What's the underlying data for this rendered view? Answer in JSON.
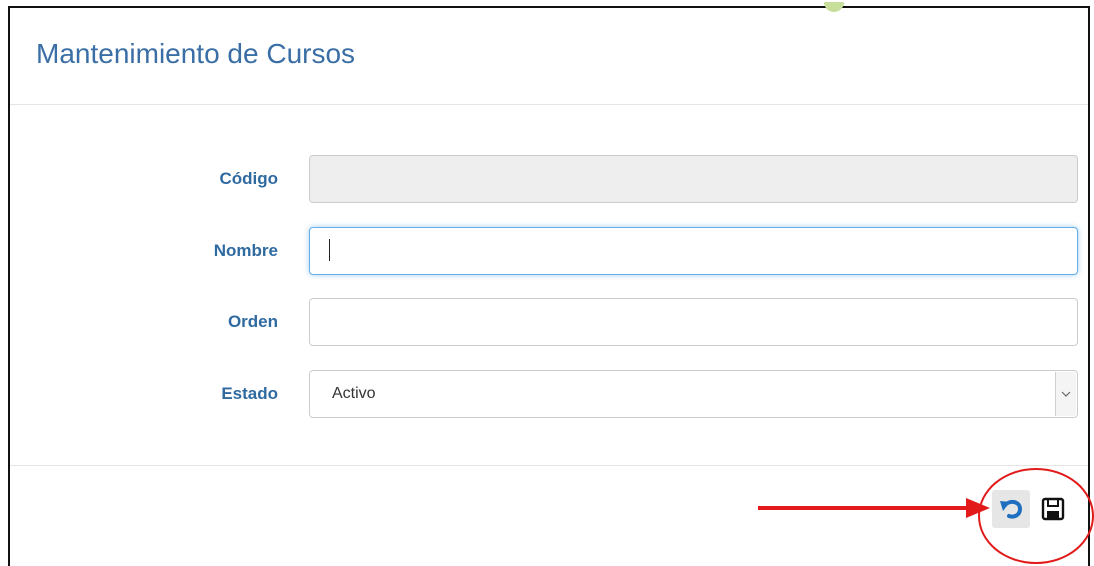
{
  "page": {
    "title": "Mantenimiento de Cursos"
  },
  "form": {
    "fields": [
      {
        "label": "Código",
        "value": "",
        "placeholder": "",
        "readonly": true
      },
      {
        "label": "Nombre",
        "value": "",
        "placeholder": "",
        "focused": true
      },
      {
        "label": "Orden",
        "value": "",
        "placeholder": ""
      },
      {
        "label": "Estado",
        "selected": "Activo"
      }
    ]
  },
  "toolbar": {
    "undo_icon": "undo-icon",
    "save_icon": "floppy-save-icon",
    "accent_color": "#1f6fc0"
  },
  "annotation": {
    "color": "#e21a1a",
    "shapes": [
      "arrow",
      "circle"
    ]
  }
}
